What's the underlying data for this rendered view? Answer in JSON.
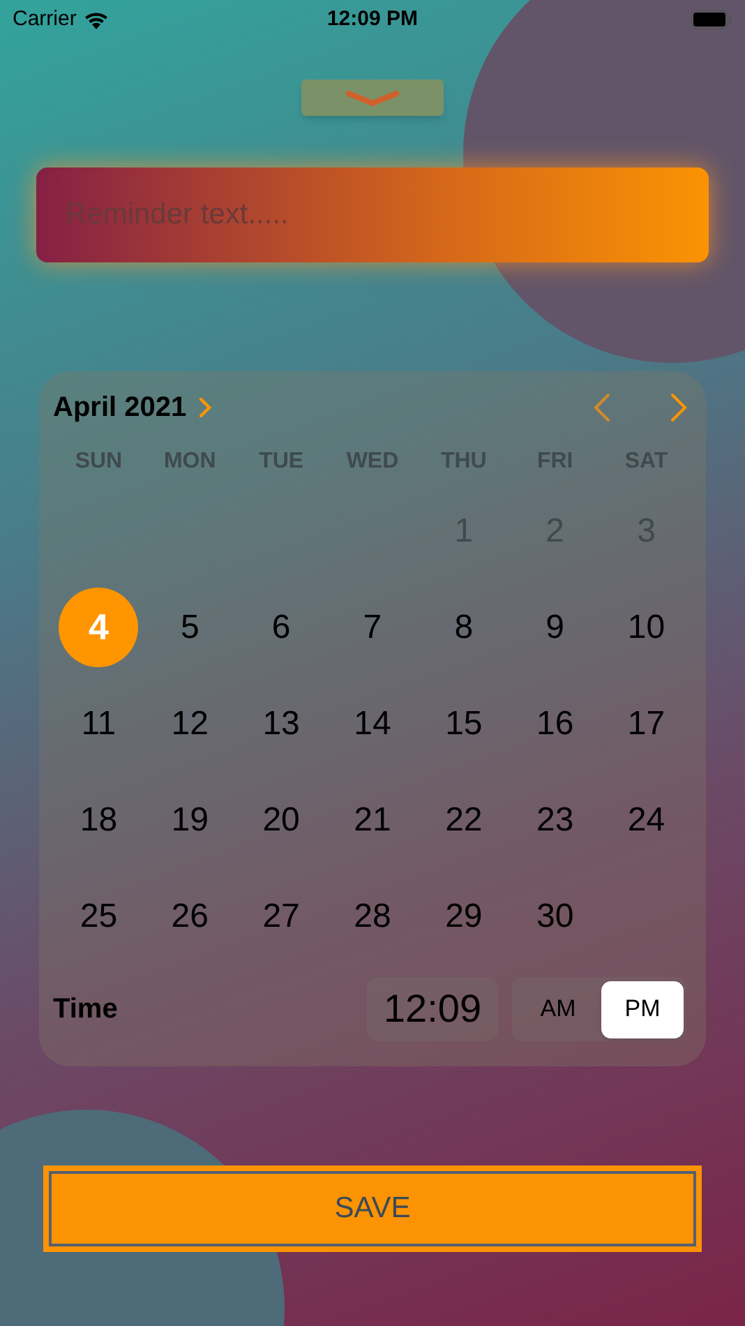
{
  "status_bar": {
    "carrier": "Carrier",
    "time": "12:09 PM"
  },
  "reminder": {
    "placeholder": "Reminder text....."
  },
  "calendar": {
    "month": "April 2021",
    "weekdays": [
      "SUN",
      "MON",
      "TUE",
      "WED",
      "THU",
      "FRI",
      "SAT"
    ],
    "weeks": [
      [
        {
          "day": "1",
          "disabled": true,
          "selected": false
        },
        {
          "day": "2",
          "disabled": true,
          "selected": false
        },
        {
          "day": "3",
          "disabled": true,
          "selected": false
        }
      ],
      [
        {
          "day": "4",
          "disabled": false,
          "selected": true
        },
        {
          "day": "5",
          "disabled": false,
          "selected": false
        },
        {
          "day": "6",
          "disabled": false,
          "selected": false
        },
        {
          "day": "7",
          "disabled": false,
          "selected": false
        },
        {
          "day": "8",
          "disabled": false,
          "selected": false
        },
        {
          "day": "9",
          "disabled": false,
          "selected": false
        },
        {
          "day": "10",
          "disabled": false,
          "selected": false
        }
      ],
      [
        {
          "day": "11",
          "disabled": false,
          "selected": false
        },
        {
          "day": "12",
          "disabled": false,
          "selected": false
        },
        {
          "day": "13",
          "disabled": false,
          "selected": false
        },
        {
          "day": "14",
          "disabled": false,
          "selected": false
        },
        {
          "day": "15",
          "disabled": false,
          "selected": false
        },
        {
          "day": "16",
          "disabled": false,
          "selected": false
        },
        {
          "day": "17",
          "disabled": false,
          "selected": false
        }
      ],
      [
        {
          "day": "18",
          "disabled": false,
          "selected": false
        },
        {
          "day": "19",
          "disabled": false,
          "selected": false
        },
        {
          "day": "20",
          "disabled": false,
          "selected": false
        },
        {
          "day": "21",
          "disabled": false,
          "selected": false
        },
        {
          "day": "22",
          "disabled": false,
          "selected": false
        },
        {
          "day": "23",
          "disabled": false,
          "selected": false
        },
        {
          "day": "24",
          "disabled": false,
          "selected": false
        }
      ],
      [
        {
          "day": "25",
          "disabled": false,
          "selected": false
        },
        {
          "day": "26",
          "disabled": false,
          "selected": false
        },
        {
          "day": "27",
          "disabled": false,
          "selected": false
        },
        {
          "day": "28",
          "disabled": false,
          "selected": false
        },
        {
          "day": "29",
          "disabled": false,
          "selected": false
        },
        {
          "day": "30",
          "disabled": false,
          "selected": false
        }
      ]
    ],
    "time_label": "Time",
    "time": "12:09",
    "periods": [
      {
        "label": "AM",
        "selected": false
      },
      {
        "label": "PM",
        "selected": true
      }
    ]
  },
  "save_button": "SAVE"
}
